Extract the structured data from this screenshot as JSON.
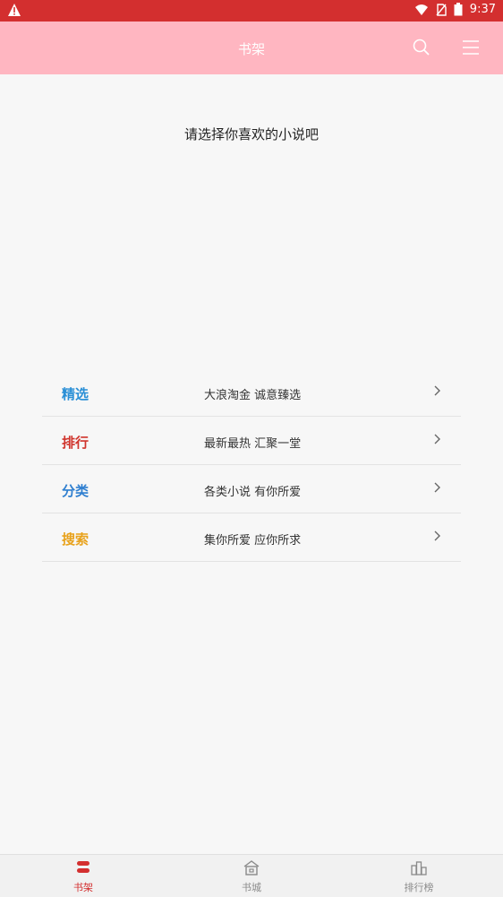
{
  "status_bar": {
    "time": "9:37",
    "warning_icon": "warning-icon"
  },
  "app_bar": {
    "title": "书架"
  },
  "prompt": "请选择你喜欢的小说吧",
  "menu": [
    {
      "title": "精选",
      "subtitle": "大浪淘金  诚意臻选",
      "color": "#2a8fd6"
    },
    {
      "title": "排行",
      "subtitle": "最新最热  汇聚一堂",
      "color": "#d0342c"
    },
    {
      "title": "分类",
      "subtitle": "各类小说  有你所爱",
      "color": "#2f7fd0"
    },
    {
      "title": "搜索",
      "subtitle": "集你所爱  应你所求",
      "color": "#e8a21c"
    }
  ],
  "bottom_nav": [
    {
      "label": "书架",
      "active": true
    },
    {
      "label": "书城",
      "active": false
    },
    {
      "label": "排行榜",
      "active": false
    }
  ]
}
